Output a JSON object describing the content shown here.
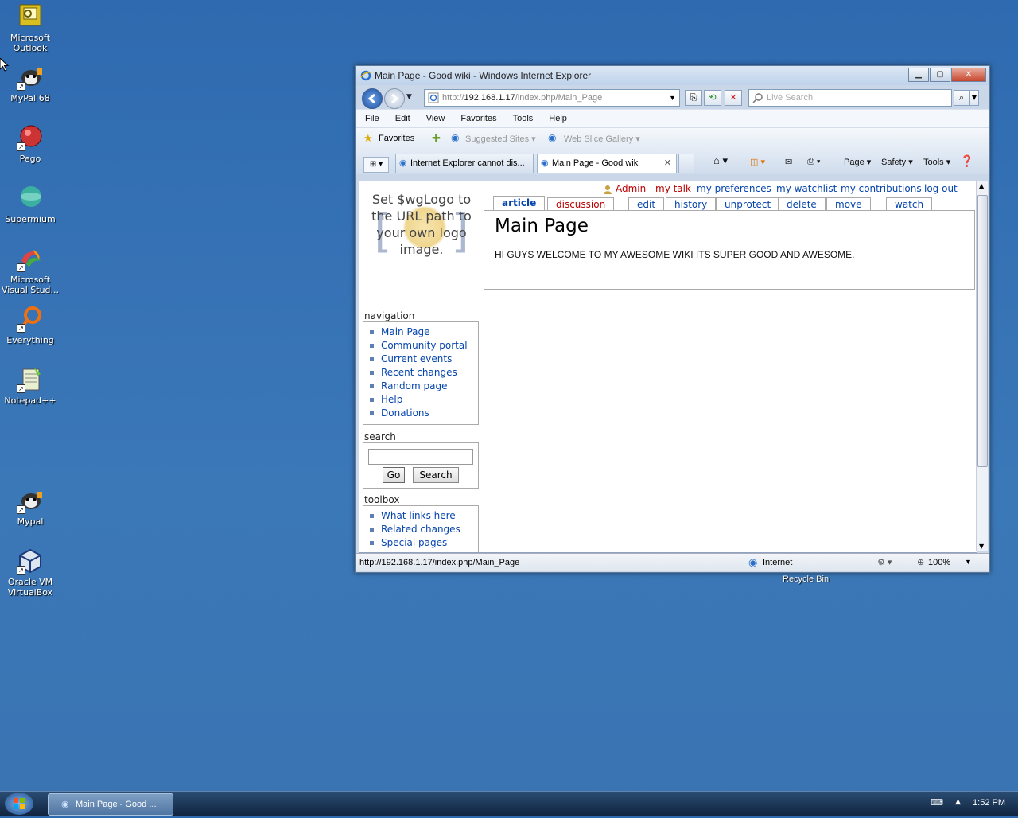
{
  "desktop": {
    "icons": [
      {
        "label": "Microsoft Outlook",
        "icon": "outlook-icon"
      },
      {
        "label": "MyPal 68",
        "icon": "mypal-icon"
      },
      {
        "label": "Pego",
        "icon": "pego-icon"
      },
      {
        "label": "Supermium",
        "icon": "supermium-icon"
      },
      {
        "label": "Microsoft Visual Stud...",
        "icon": "visual-studio-icon"
      },
      {
        "label": "Everything",
        "icon": "everything-icon"
      },
      {
        "label": "Notepad++",
        "icon": "notepadpp-icon"
      },
      {
        "label": "Mypal",
        "icon": "mypal-icon"
      },
      {
        "label": "Oracle VM VirtualBox",
        "icon": "virtualbox-icon"
      }
    ],
    "recycle_bin": "Recycle Bin"
  },
  "window": {
    "title": "Main Page - Good wiki - Windows Internet Explorer",
    "address_prefix": "http://",
    "address_host": "192.168.1.17",
    "address_path": "/index.php/Main_Page",
    "search_placeholder": "Live Search",
    "menu": [
      "File",
      "Edit",
      "View",
      "Favorites",
      "Tools",
      "Help"
    ],
    "favorites_label": "Favorites",
    "suggested_sites": "Suggested Sites",
    "web_slice_gallery": "Web Slice Gallery",
    "tabs": [
      {
        "label": "Internet Explorer cannot dis..."
      },
      {
        "label": "Main Page - Good wiki"
      }
    ],
    "commands": {
      "page": "Page",
      "safety": "Safety",
      "tools": "Tools"
    },
    "status_url": "http://192.168.1.17/index.php/Main_Page",
    "zone": "Internet",
    "zoom": "100%"
  },
  "wiki": {
    "logo_text": "Set $wgLogo to the URL path to your own logo image.",
    "personal": {
      "user": "Admin",
      "talk": "my talk",
      "prefs": "my preferences",
      "watchlist": "my watchlist",
      "contribs": "my contributions",
      "logout": "log out"
    },
    "tabs": {
      "article": "article",
      "discussion": "discussion",
      "edit": "edit",
      "history": "history",
      "unprotect": "unprotect",
      "delete": "delete",
      "move": "move",
      "watch": "watch"
    },
    "page_title": "Main Page",
    "body_text": "HI GUYS WELCOME TO MY AWESOME WIKI ITS SUPER GOOD AND AWESOME.",
    "navigation": {
      "heading": "navigation",
      "items": [
        "Main Page",
        "Community portal",
        "Current events",
        "Recent changes",
        "Random page",
        "Help",
        "Donations"
      ]
    },
    "search": {
      "heading": "search",
      "go": "Go",
      "search": "Search"
    },
    "toolbox": {
      "heading": "toolbox",
      "items": [
        "What links here",
        "Related changes",
        "Special pages"
      ]
    }
  },
  "taskbar": {
    "button": "Main Page - Good ...",
    "clock": "1:52 PM"
  }
}
